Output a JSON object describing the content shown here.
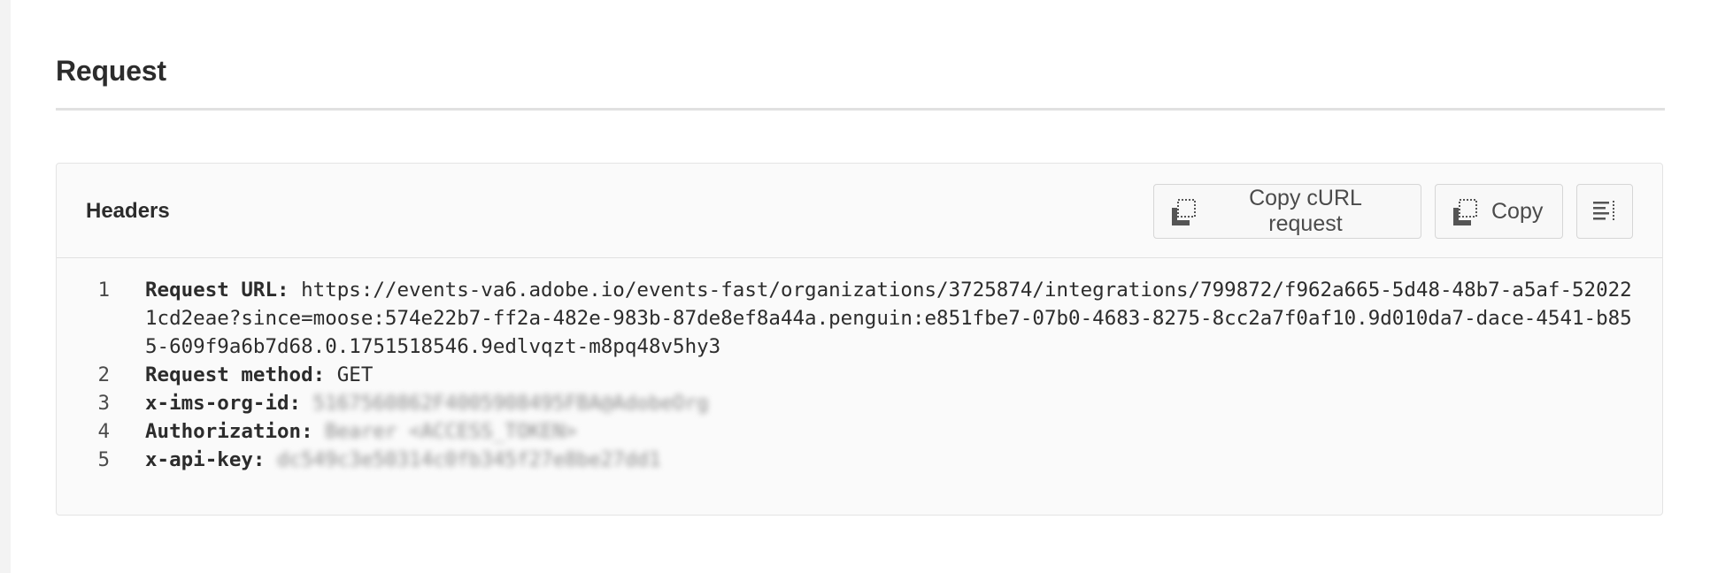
{
  "section": {
    "title": "Request"
  },
  "panel": {
    "title": "Headers",
    "buttons": {
      "copy_curl_label": "Copy cURL request",
      "copy_label": "Copy"
    },
    "icons": {
      "copy_curl": "copy-icon",
      "copy": "copy-icon",
      "wrap": "text-wrap-icon"
    }
  },
  "code_lines": [
    {
      "number": "1",
      "key": "Request URL:",
      "value": "https://events-va6.adobe.io/events-fast/organizations/3725874/integrations/799872/f962a665-5d48-48b7-a5af-520221cd2eae?since=moose:574e22b7-ff2a-482e-983b-87de8ef8a44a.penguin:e851fbe7-07b0-4683-8275-8cc2a7f0af10.9d010da7-dace-4541-b855-609f9a6b7d68.0.1751518546.9edlvqzt-m8pq48v5hy3"
    },
    {
      "number": "2",
      "key": "Request method:",
      "value": "GET"
    },
    {
      "number": "3",
      "key": "x-ims-org-id:",
      "value": "5167560862F4005908495FBA@AdobeOrg"
    },
    {
      "number": "4",
      "key": "Authorization:",
      "value": "Bearer <ACCESS_TOKEN>"
    },
    {
      "number": "5",
      "key": "x-api-key:",
      "value": "dc549c3e50314c0fb345f27e8be27dd1"
    }
  ]
}
